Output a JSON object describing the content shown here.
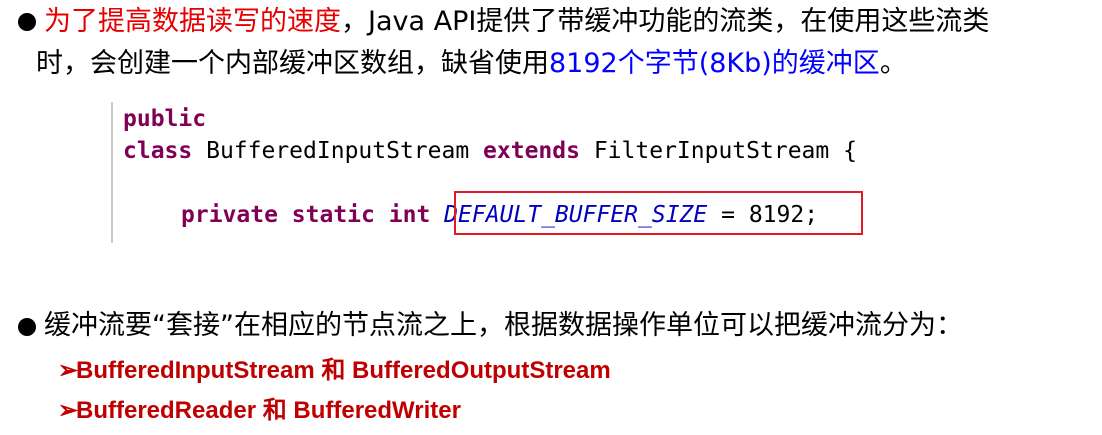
{
  "bullet1": {
    "red_part": "为了提高数据读写的速度",
    "part2": "，Java API提供了带缓冲功能的流类，在使用这些流类",
    "line2_part1": "时，会创建一个内部缓冲区数组，缺省使用",
    "line2_blue": "8192个字节(8Kb)的缓冲区",
    "line2_end": "。"
  },
  "code": {
    "kw_public": "public",
    "kw_class": "class",
    "class_name": " BufferedInputStream ",
    "kw_extends": "extends",
    "super_name": " FilterInputStream {",
    "kw_private": "private",
    "kw_static": "static",
    "kw_int": "int",
    "const_name": "DEFAULT_BUFFER_SIZE",
    "equals": " = ",
    "value": "8192",
    "semicolon": ";"
  },
  "bullet2": {
    "text": "缓冲流要“套接”在相应的节点流之上，根据数据操作单位可以把缓冲流分为：",
    "items": [
      "BufferedInputStream 和 BufferedOutputStream",
      "BufferedReader 和 BufferedWriter"
    ],
    "arrow": "➢"
  }
}
